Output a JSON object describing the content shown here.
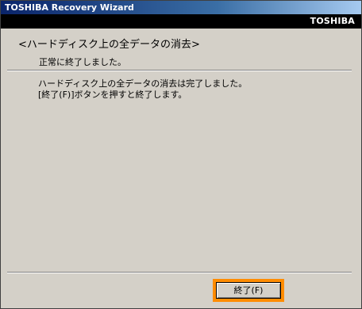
{
  "window": {
    "title": "TOSHIBA Recovery Wizard",
    "brand": "TOSHIBA"
  },
  "main": {
    "heading": "<ハードディスク上の全データの消去>",
    "subheading": "正常に終了しました。",
    "body_lines": [
      "ハードディスク上の全データの消去は完了しました。",
      "[終了(F)]ボタンを押すと終了します。"
    ]
  },
  "footer": {
    "finish_label": "終了(F)"
  },
  "colors": {
    "highlight": "#ff8c00",
    "titlebar": "#0a246a",
    "background": "#d4d0c8"
  }
}
